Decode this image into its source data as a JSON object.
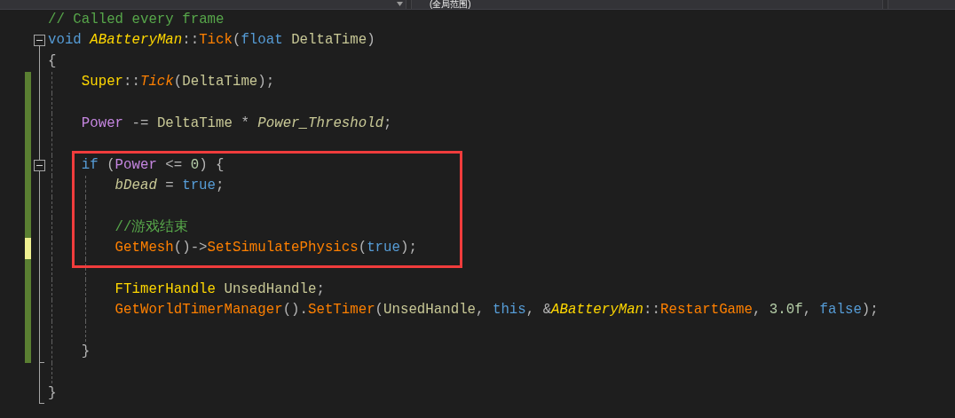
{
  "scope_dropdown": {
    "value": "(全局范围)"
  },
  "lines": [
    {
      "kind": "code",
      "tokens": [
        {
          "text": "// Called every frame",
          "kind": "comment"
        }
      ]
    },
    {
      "kind": "code",
      "expanded": true,
      "tokens": [
        {
          "text": "void ",
          "kind": "keyword"
        },
        {
          "text": "ABatteryMan",
          "kind": "class-italic"
        },
        {
          "text": "::",
          "kind": "punct"
        },
        {
          "text": "Tick",
          "kind": "function"
        },
        {
          "text": "(",
          "kind": "punct"
        },
        {
          "text": "float ",
          "kind": "keyword"
        },
        {
          "text": "DeltaTime",
          "kind": "local"
        },
        {
          "text": ")",
          "kind": "punct"
        }
      ]
    },
    {
      "kind": "code",
      "tokens": [
        {
          "text": "{",
          "kind": "punct"
        }
      ],
      "children": [
        {
          "kind": "code",
          "modified": true,
          "saved": true,
          "tokens": [
            {
              "text": "Super",
              "kind": "class"
            },
            {
              "text": "::",
              "kind": "punct"
            },
            {
              "text": "Tick",
              "kind": "function-italic"
            },
            {
              "text": "(",
              "kind": "punct"
            },
            {
              "text": "DeltaTime",
              "kind": "local"
            },
            {
              "text": ");",
              "kind": "punct"
            }
          ]
        },
        {
          "kind": "blank",
          "modified": true,
          "saved": true
        },
        {
          "kind": "code",
          "modified": true,
          "saved": true,
          "tokens": [
            {
              "text": "Power",
              "kind": "field"
            },
            {
              "text": " -= ",
              "kind": "punct"
            },
            {
              "text": "DeltaTime",
              "kind": "local"
            },
            {
              "text": " * ",
              "kind": "punct"
            },
            {
              "text": "Power_Threshold",
              "kind": "field-italic"
            },
            {
              "text": ";",
              "kind": "punct"
            }
          ]
        },
        {
          "kind": "blank",
          "modified": true,
          "saved": true
        },
        {
          "kind": "code",
          "modified": true,
          "saved": true,
          "expanded": true,
          "boxed": true,
          "tokens": [
            {
              "text": "if",
              "kind": "keyword"
            },
            {
              "text": " (",
              "kind": "punct"
            },
            {
              "text": "Power",
              "kind": "field"
            },
            {
              "text": " <= ",
              "kind": "punct"
            },
            {
              "text": "0",
              "kind": "number"
            },
            {
              "text": ") {",
              "kind": "punct"
            }
          ],
          "children": [
            {
              "kind": "code",
              "modified": true,
              "saved": true,
              "boxed": true,
              "tokens": [
                {
                  "text": "bDead",
                  "kind": "field-italic"
                },
                {
                  "text": " = ",
                  "kind": "punct"
                },
                {
                  "text": "true",
                  "kind": "keyword"
                },
                {
                  "text": ";",
                  "kind": "punct"
                }
              ]
            },
            {
              "kind": "blank",
              "modified": true,
              "saved": true,
              "boxed": true
            },
            {
              "kind": "code",
              "modified": true,
              "saved": true,
              "boxed": true,
              "tokens": [
                {
                  "text": "//游戏结束",
                  "kind": "comment"
                }
              ]
            },
            {
              "kind": "code",
              "modified": true,
              "saved": false,
              "boxed": true,
              "tokens": [
                {
                  "text": "GetMesh",
                  "kind": "function"
                },
                {
                  "text": "()->",
                  "kind": "punct"
                },
                {
                  "text": "SetSimulatePhysics",
                  "kind": "function"
                },
                {
                  "text": "(",
                  "kind": "punct"
                },
                {
                  "text": "true",
                  "kind": "keyword"
                },
                {
                  "text": ");",
                  "kind": "punct"
                }
              ]
            },
            {
              "kind": "blank",
              "modified": true,
              "saved": true
            },
            {
              "kind": "code",
              "modified": true,
              "saved": true,
              "tokens": [
                {
                  "text": "FTimerHandle ",
                  "kind": "class"
                },
                {
                  "text": "UnsedHandle",
                  "kind": "local"
                },
                {
                  "text": ";",
                  "kind": "punct"
                }
              ]
            },
            {
              "kind": "code",
              "modified": true,
              "saved": true,
              "tokens": [
                {
                  "text": "GetWorldTimerManager",
                  "kind": "function"
                },
                {
                  "text": "().",
                  "kind": "punct"
                },
                {
                  "text": "SetTimer",
                  "kind": "function"
                },
                {
                  "text": "(",
                  "kind": "punct"
                },
                {
                  "text": "UnsedHandle",
                  "kind": "local"
                },
                {
                  "text": ", ",
                  "kind": "punct"
                },
                {
                  "text": "this",
                  "kind": "keyword"
                },
                {
                  "text": ", &",
                  "kind": "punct"
                },
                {
                  "text": "ABatteryMan",
                  "kind": "class-italic"
                },
                {
                  "text": "::",
                  "kind": "punct"
                },
                {
                  "text": "RestartGame",
                  "kind": "function"
                },
                {
                  "text": ", ",
                  "kind": "punct"
                },
                {
                  "text": "3.0f",
                  "kind": "number"
                },
                {
                  "text": ", ",
                  "kind": "punct"
                },
                {
                  "text": "false",
                  "kind": "keyword"
                },
                {
                  "text": ");",
                  "kind": "punct"
                }
              ]
            },
            {
              "kind": "blank",
              "modified": true,
              "saved": true
            }
          ]
        },
        {
          "kind": "code",
          "modified": true,
          "saved": true,
          "tokens": [
            {
              "text": "}",
              "kind": "punct"
            }
          ]
        },
        {
          "kind": "blank"
        }
      ]
    },
    {
      "kind": "code",
      "tokens": [
        {
          "text": "}",
          "kind": "punct"
        }
      ]
    }
  ]
}
